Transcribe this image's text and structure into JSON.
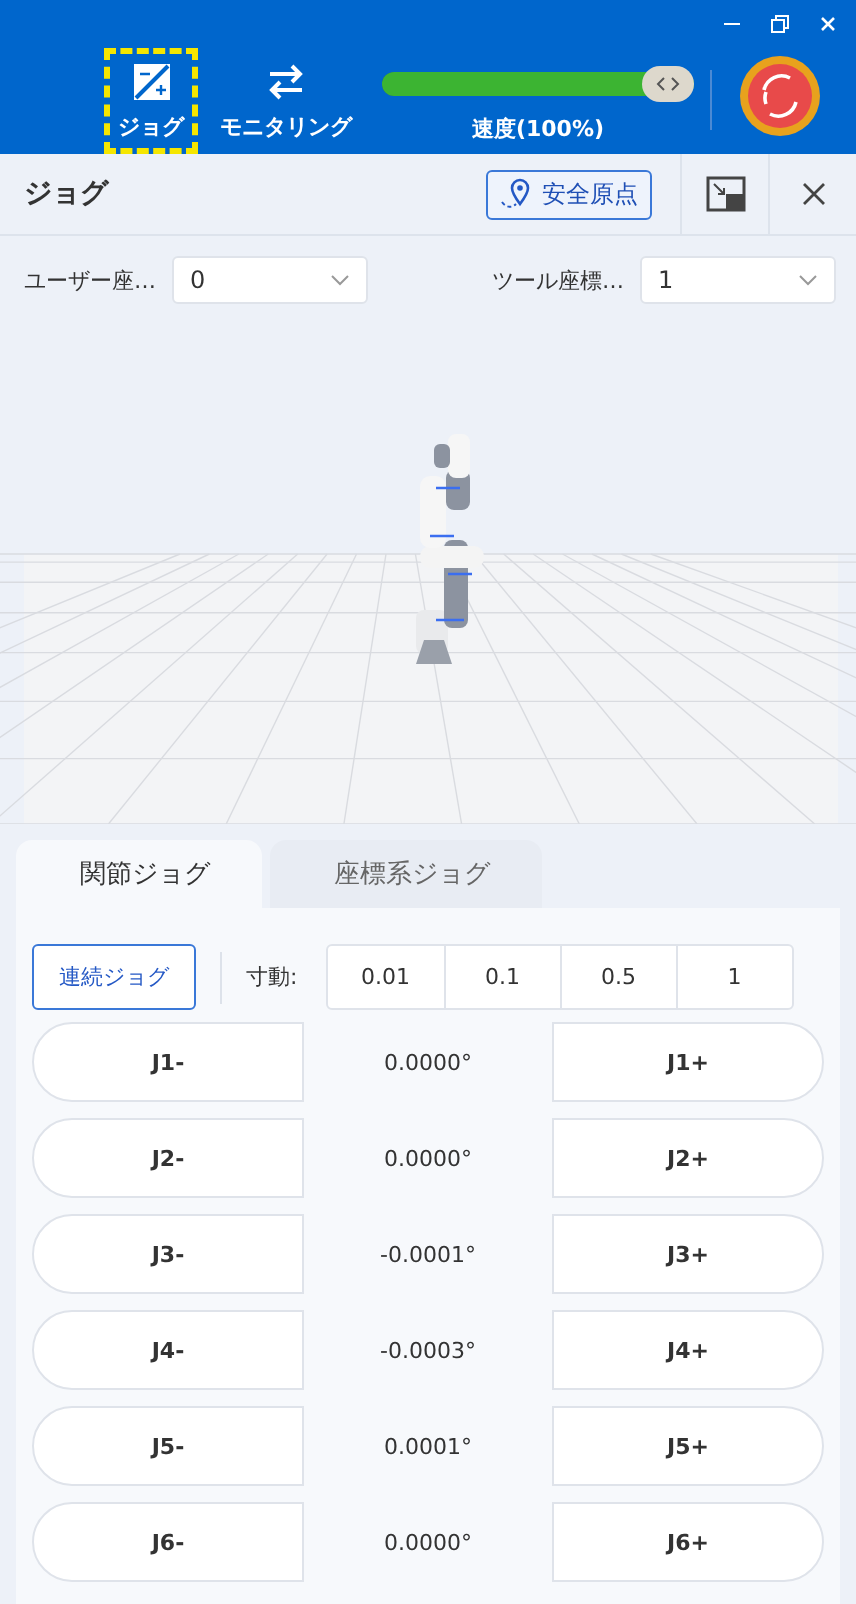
{
  "nav": [
    {
      "label": "ジョグ",
      "kind": "jog",
      "selected": true
    },
    {
      "label": "モニタリング",
      "kind": "monitor",
      "selected": false
    }
  ],
  "speed": {
    "level": 1,
    "label": "速度(100%)"
  },
  "panel": {
    "title": "ジョグ",
    "home_button": "安全原点"
  },
  "selects": [
    {
      "label": "ユーザー座…",
      "value": "0"
    },
    {
      "label": "ツール座標…",
      "value": "1"
    }
  ],
  "tabs": [
    {
      "label": "関節ジョグ",
      "selected": true
    },
    {
      "label": "座標系ジョグ",
      "selected": false
    }
  ],
  "continuous_button": "連続ジョグ",
  "step": {
    "label": "寸動:",
    "options": [
      "0.01",
      "0.1",
      "0.5",
      "1"
    ]
  },
  "joints": [
    {
      "minus": "J1-",
      "value": "0.0000°",
      "plus": "J1+"
    },
    {
      "minus": "J2-",
      "value": "0.0000°",
      "plus": "J2+"
    },
    {
      "minus": "J3-",
      "value": "-0.0001°",
      "plus": "J3+"
    },
    {
      "minus": "J4-",
      "value": "-0.0003°",
      "plus": "J4+"
    },
    {
      "minus": "J5-",
      "value": "0.0001°",
      "plus": "J5+"
    },
    {
      "minus": "J6-",
      "value": "0.0000°",
      "plus": "J6+"
    }
  ]
}
